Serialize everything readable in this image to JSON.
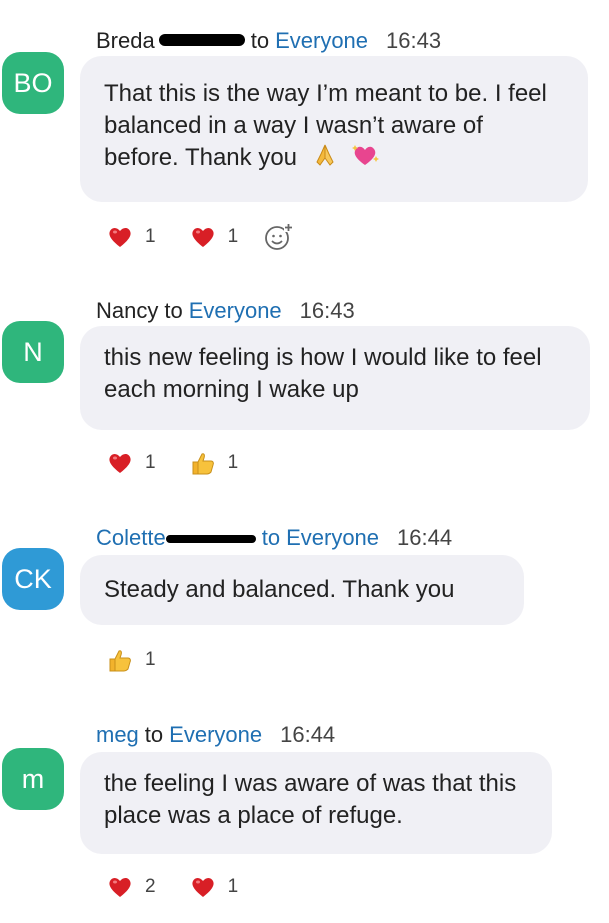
{
  "messages": [
    {
      "avatar": "BO",
      "avatar_color": "#2fb67c",
      "sender": "Breda",
      "to": "to",
      "recipient": "Everyone",
      "time": "16:43",
      "text": "That this is the way I’m meant to be. I feel balanced in a way I wasn’t aware of before. Thank you",
      "inline_emojis": [
        "folded-hands-icon",
        "heart-with-sparkles-icon"
      ],
      "reactions": [
        {
          "icon": "heart-icon",
          "count": "1"
        },
        {
          "icon": "heart-icon",
          "count": "1"
        }
      ]
    },
    {
      "avatar": "N",
      "avatar_color": "#2fb67c",
      "sender": "Nancy",
      "to": "to",
      "recipient": "Everyone",
      "time": "16:43",
      "text": "this new feeling is  how I would like to feel each morning I wake up",
      "reactions": [
        {
          "icon": "heart-icon",
          "count": "1"
        },
        {
          "icon": "thumbs-up-icon",
          "count": "1"
        }
      ]
    },
    {
      "avatar": "CK",
      "avatar_color": "#2f9ad6",
      "sender": "Colette",
      "to": "to",
      "recipient": "Everyone",
      "time": "16:44",
      "text": "Steady and balanced. Thank you",
      "reactions": [
        {
          "icon": "thumbs-up-icon",
          "count": "1"
        }
      ]
    },
    {
      "avatar": "m",
      "avatar_color": "#2fb67c",
      "sender": "meg",
      "to": "to",
      "recipient": "Everyone",
      "time": "16:44",
      "text": "the feeling I was aware of was that this place was a place of refuge.",
      "reactions": [
        {
          "icon": "heart-icon",
          "count": "2"
        },
        {
          "icon": "heart-icon",
          "count": "1"
        }
      ]
    }
  ]
}
